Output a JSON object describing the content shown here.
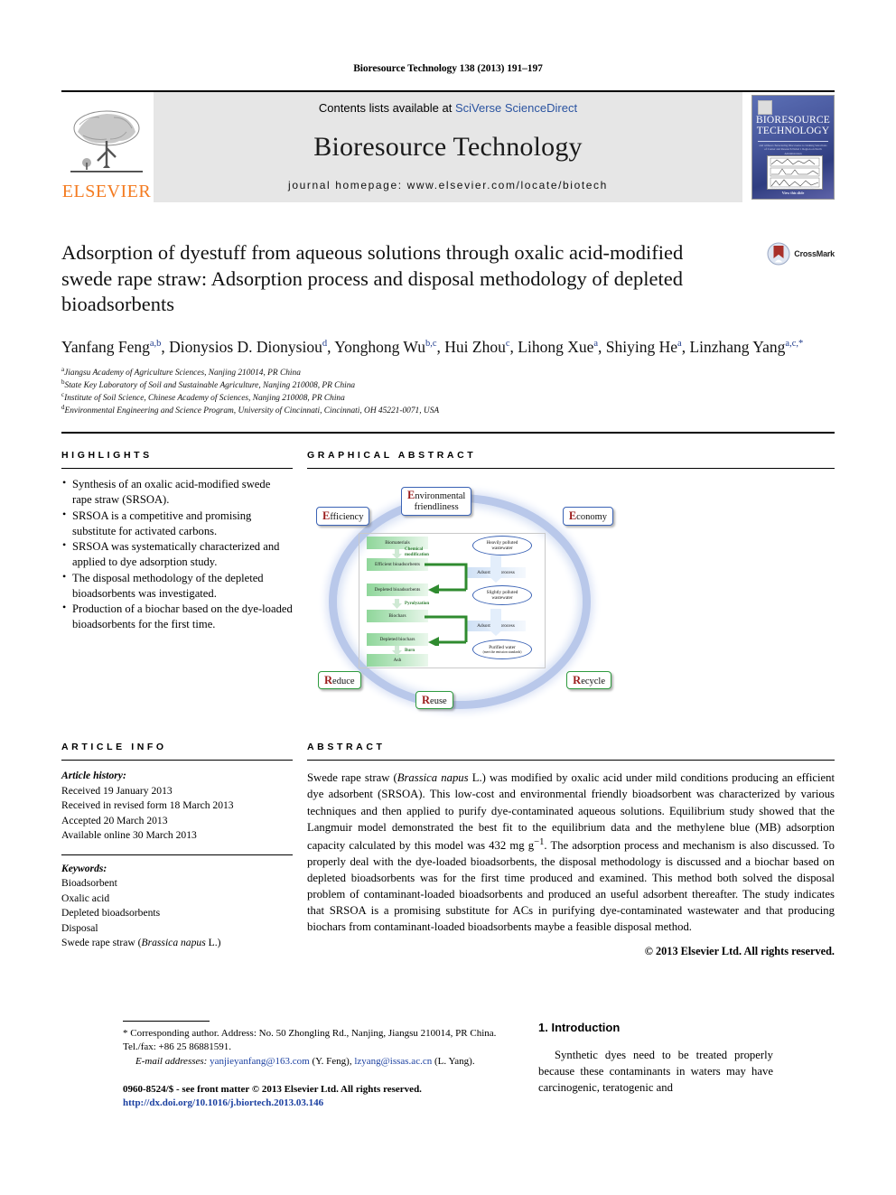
{
  "running_head": "Bioresource Technology 138 (2013) 191–197",
  "masthead": {
    "publisher_logo_text": "ELSEVIER",
    "contents_prefix": "Contents lists available at ",
    "contents_link": "SciVerse ScienceDirect",
    "journal_title": "Bioresource Technology",
    "homepage_line": "journal homepage: www.elsevier.com/locate/biotech",
    "cover": {
      "line1": "BIORESOURCE",
      "line2": "TECHNOLOGY",
      "subtitle": "and without charactering Discoverus to Linking Selections of Corner and Research Nobel 1 Region on North Administration",
      "footer_small": "AN INTERNATIONAL JOURNAL",
      "footer_link": "View this slide"
    }
  },
  "article": {
    "title": "Adsorption of dyestuff from aqueous solutions through oxalic acid-modified swede rape straw: Adsorption process and disposal methodology of depleted bioadsorbents",
    "crossmark_label": "CrossMark",
    "authors": [
      {
        "name": "Yanfang Feng",
        "sup": "a,b",
        "sep": ", "
      },
      {
        "name": "Dionysios D. Dionysiou",
        "sup": "d",
        "sep": ", "
      },
      {
        "name": "Yonghong Wu",
        "sup": "b,c",
        "sep": ", "
      },
      {
        "name": "Hui Zhou",
        "sup": "c",
        "sep": ", "
      },
      {
        "name": "Lihong Xue",
        "sup": "a",
        "sep": ", "
      },
      {
        "name": "Shiying He",
        "sup": "a",
        "sep": ", "
      },
      {
        "name": "Linzhang Yang",
        "sup": "a,c,*",
        "sep": ""
      }
    ],
    "affiliations": [
      {
        "marker": "a",
        "text": "Jiangsu Academy of Agriculture Sciences, Nanjing 210014, PR China"
      },
      {
        "marker": "b",
        "text": "State Key Laboratory of Soil and Sustainable Agriculture, Nanjing 210008, PR China"
      },
      {
        "marker": "c",
        "text": "Institute of Soil Science, Chinese Academy of Sciences, Nanjing 210008, PR China"
      },
      {
        "marker": "d",
        "text": "Environmental Engineering and Science Program, University of Cincinnati, Cincinnati, OH 45221-0071, USA"
      }
    ]
  },
  "highlights": {
    "label": "HIGHLIGHTS",
    "items": [
      "Synthesis of an oxalic acid-modified swede rape straw (SRSOA).",
      "SRSOA is a competitive and promising substitute for activated carbons.",
      "SRSOA was systematically characterized and applied to dye adsorption study.",
      "The disposal methodology of the depleted bioadsorbents was investigated.",
      "Production of a biochar based on the dye-loaded bioadsorbents for the first time."
    ]
  },
  "graphical_abstract": {
    "label": "GRAPHICAL ABSTRACT",
    "outer_nodes": [
      {
        "cap": "E",
        "rest": "fficiency"
      },
      {
        "cap": "E",
        "rest": "nvironmental",
        "line2": "friendliness"
      },
      {
        "cap": "E",
        "rest": "conomy"
      },
      {
        "cap": "R",
        "rest": "educe"
      },
      {
        "cap": "R",
        "rest": "euse"
      },
      {
        "cap": "R",
        "rest": "ecycle"
      }
    ],
    "flow_left": [
      "Biomaterials",
      "Efficient bioadsorbents",
      "Depleted bioadsorbents",
      "Biochars",
      "Depleted biochars",
      "Ash"
    ],
    "arrow_labels": [
      "Chemical modification",
      "Pyrolyzation",
      "Burn"
    ],
    "process_boxes": [
      "Adsorption process",
      "Adsorption process"
    ],
    "water_ovals": [
      {
        "line1": "Heavily polluted",
        "line2": "wastewater"
      },
      {
        "line1": "Slightly polluted",
        "line2": "wastewater"
      },
      {
        "line1": "Purified water",
        "line2": "(meet the emission standards)"
      }
    ]
  },
  "article_info": {
    "label": "ARTICLE INFO",
    "history_head": "Article history:",
    "history": [
      "Received 19 January 2013",
      "Received in revised form 18 March 2013",
      "Accepted 20 March 2013",
      "Available online 30 March 2013"
    ],
    "keywords_head": "Keywords:",
    "keywords": [
      "Bioadsorbent",
      "Oxalic acid",
      "Depleted bioadsorbents",
      "Disposal"
    ],
    "keyword_last_pre": "Swede rape straw (",
    "keyword_last_italic": "Brassica napus",
    "keyword_last_post": " L.)"
  },
  "abstract": {
    "label": "ABSTRACT",
    "part1": "Swede rape straw (",
    "species": "Brassica napus",
    "part2": " L.) was modified by oxalic acid under mild conditions producing an efficient dye adsorbent (SRSOA). This low-cost and environmental friendly bioadsorbent was characterized by various techniques and then applied to purify dye-contaminated aqueous solutions. Equilibrium study showed that the Langmuir model demonstrated the best fit to the equilibrium data and the methylene blue (MB) adsorption capacity calculated by this model was 432 mg g",
    "exponent": "−1",
    "part3": ". The adsorption process and mechanism is also discussed. To properly deal with the dye-loaded bioadsorbents, the disposal methodology is discussed and a biochar based on depleted bioadsorbents was for the first time produced and examined. This method both solved the disposal problem of contaminant-loaded bioadsorbents and produced an useful adsorbent thereafter. The study indicates that SRSOA is a promising substitute for ACs in purifying dye-contaminated wastewater and that producing biochars from contaminant-loaded bioadsorbents maybe a feasible disposal method.",
    "copyright": "© 2013 Elsevier Ltd. All rights reserved."
  },
  "footer": {
    "corresponding_star": "*",
    "corresponding_text": " Corresponding author. Address: No. 50 Zhongling Rd., Nanjing, Jiangsu 210014, PR China. Tel./fax: +86 25 86881591.",
    "email_label": "E-mail addresses:",
    "email1": "yanjieyanfang@163.com",
    "email1_owner": " (Y. Feng), ",
    "email2": "lzyang@issas.ac.cn",
    "email2_owner": " (L. Yang).",
    "issn_line": "0960-8524/$ - see front matter © 2013 Elsevier Ltd. All rights reserved.",
    "doi_line": "http://dx.doi.org/10.1016/j.biortech.2013.03.146"
  },
  "introduction": {
    "heading": "1. Introduction",
    "paragraph": "Synthetic dyes need to be treated properly because these contaminants in waters may have carcinogenic, teratogenic and"
  },
  "colors": {
    "link_blue": "#2a53a0",
    "elsevier_orange": "#f47b20",
    "sup_blue": "#1f3b8c",
    "node_blue": "#3b63b5",
    "node_green": "#2e9b3e",
    "cap_red": "#9b1c1c",
    "masthead_gray": "#e6e6e6"
  }
}
